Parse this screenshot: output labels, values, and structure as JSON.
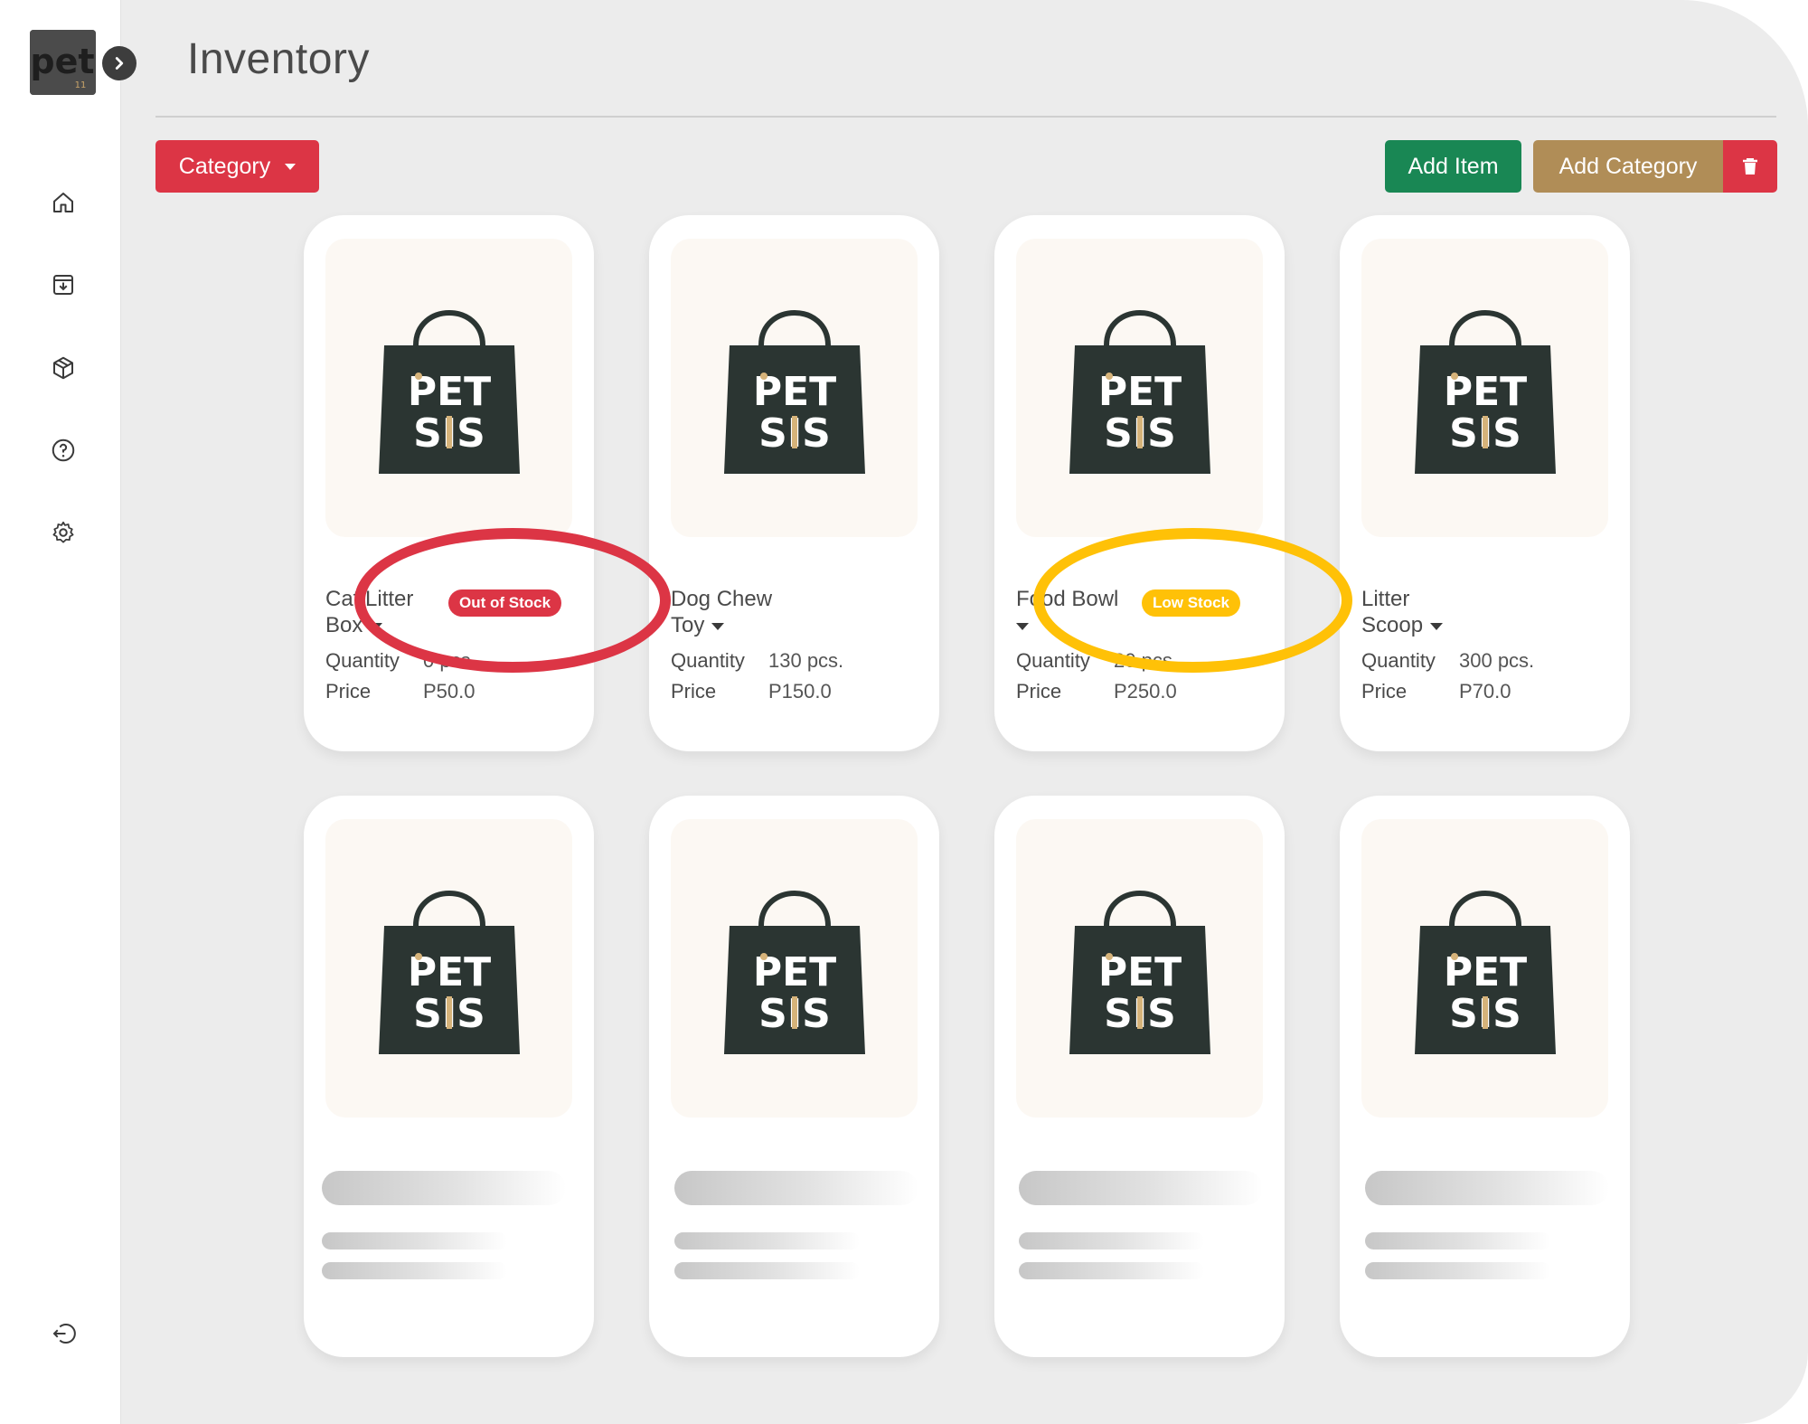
{
  "app": {
    "page_title": "Inventory",
    "logo": {
      "text": "pet",
      "icon": "pet-logo-icon"
    }
  },
  "sidebar": {
    "collapse_icon": "chevron-right-icon",
    "items": [
      {
        "icon": "home-icon"
      },
      {
        "icon": "archive-icon"
      },
      {
        "icon": "box-icon"
      },
      {
        "icon": "help-icon"
      },
      {
        "icon": "gear-icon"
      }
    ],
    "logout_icon": "logout-icon"
  },
  "toolbar": {
    "category_label": "Category",
    "add_item_label": "Add Item",
    "add_category_label": "Add Category",
    "trash_icon": "trash-icon"
  },
  "colors": {
    "danger": "#dc3545",
    "success": "#198754",
    "accent": "#b08d57",
    "warning": "#ffc107",
    "bag": "#2b3532"
  },
  "labels": {
    "quantity": "Quantity",
    "price": "Price"
  },
  "products": [
    {
      "name_line1": "Cat Litter",
      "name_line2": "Box",
      "badge": "Out of Stock",
      "quantity": "0 pcs.",
      "price": "P50.0"
    },
    {
      "name_line1": "Dog Chew",
      "name_line2": "Toy",
      "badge": "",
      "quantity": "130 pcs.",
      "price": "P150.0"
    },
    {
      "name_line1": "Food Bowl",
      "name_line2": "",
      "badge": "Low Stock",
      "quantity": "20 pcs.",
      "price": "P250.0"
    },
    {
      "name_line1": "Litter",
      "name_line2": "Scoop",
      "badge": "",
      "quantity": "300 pcs.",
      "price": "P70.0"
    }
  ],
  "product_image_text": {
    "line1": "PET",
    "line2": "SIS"
  }
}
